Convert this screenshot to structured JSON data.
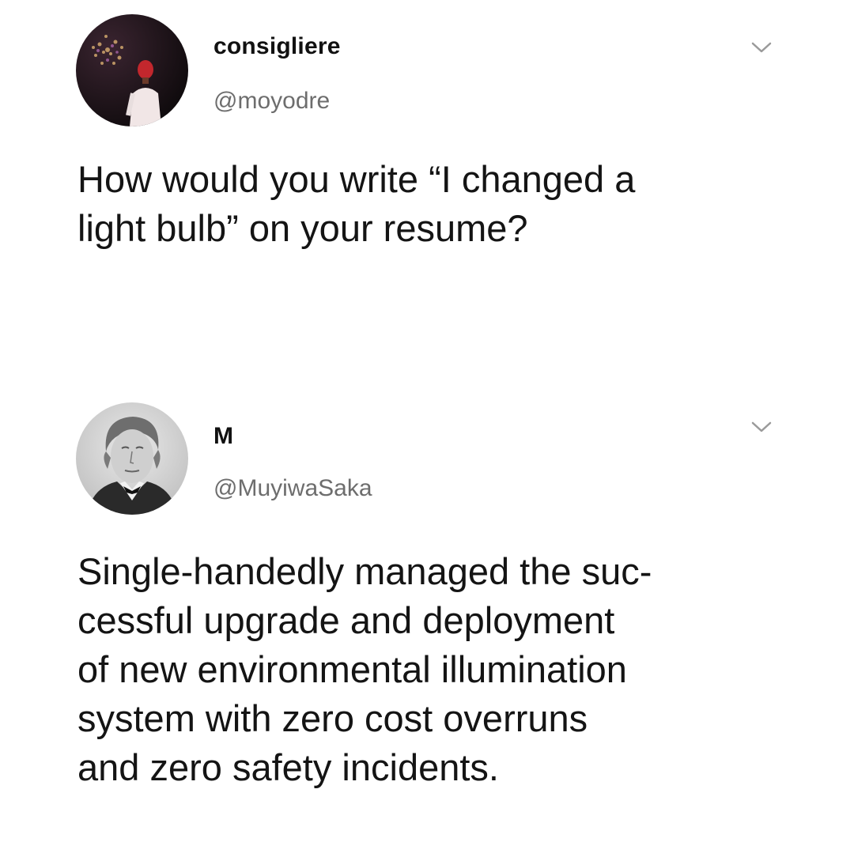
{
  "tweets": [
    {
      "display_name": "consigliere",
      "handle": "@moyodre",
      "avatar_icon": "avatar-fireworks-person-icon",
      "menu_icon": "chevron-down-icon",
      "text_lines": [
        "How would you write “I changed a",
        "light bulb” on your resume?"
      ]
    },
    {
      "display_name": "M",
      "handle": "@MuyiwaSaka",
      "avatar_icon": "avatar-vintage-portrait-icon",
      "menu_icon": "chevron-down-icon",
      "text_lines": [
        "Single-handedly managed the suc-",
        "cessful upgrade and deployment",
        "of new environmental illumination",
        "system with zero cost overruns",
        "and zero safety incidents."
      ]
    }
  ],
  "colors": {
    "background": "#ffffff",
    "text": "#141414",
    "handle": "#6d6d6d",
    "chevron": "#9a9a9a"
  }
}
